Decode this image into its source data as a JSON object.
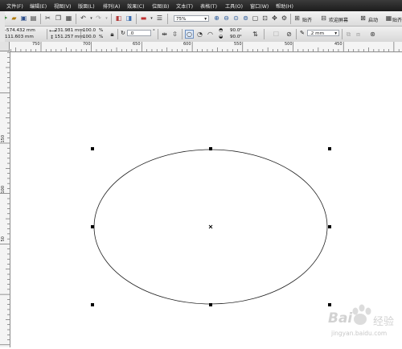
{
  "menu": [
    "文件(F)",
    "编辑(E)",
    "视图(V)",
    "版面(L)",
    "排列(A)",
    "效果(C)",
    "位图(B)",
    "文本(T)",
    "表格(T)",
    "工具(O)",
    "窗口(W)",
    "帮助(H)"
  ],
  "toolbar": {
    "zoom_value": "75%",
    "snap_label": "贴齐",
    "welcome_label": "欢迎屏幕",
    "launch_label": "启动"
  },
  "property_bar": {
    "x": "-574.432 mm",
    "y": "111.603 mm",
    "width": "231.981 mm",
    "height": "151.257 mm",
    "scale_x": "100.0",
    "scale_y": "100.0",
    "pct": "%",
    "rotation": ".0",
    "degree": "°",
    "start_angle": "90.0",
    "end_angle": "90.0",
    "outline_width": ".2 mm"
  },
  "ruler": {
    "h_labels": [
      "750",
      "700",
      "650",
      "600",
      "550",
      "500",
      "450"
    ],
    "v_labels": [
      "150",
      "100",
      "50"
    ]
  },
  "watermark": {
    "brand": "Bai",
    "brand2": "经验",
    "url": "jingyan.baidu.com"
  },
  "colors": {
    "menubar": "#2a2a2a",
    "accent": "#d40000"
  }
}
